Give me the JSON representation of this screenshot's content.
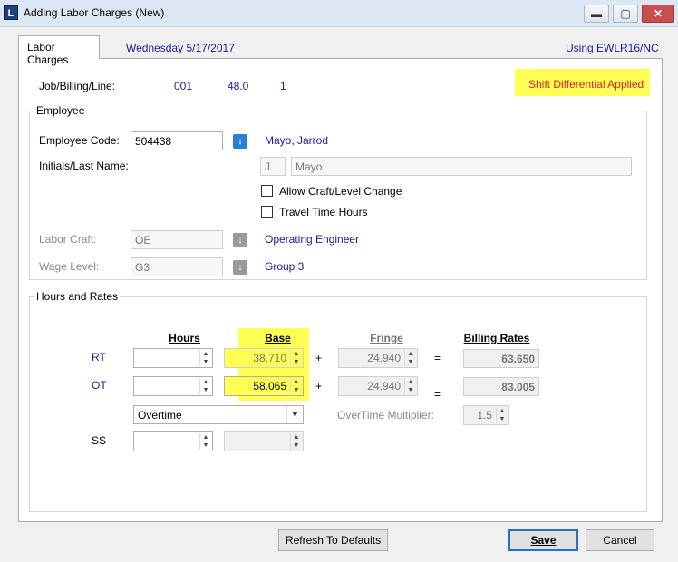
{
  "window": {
    "title": "Adding Labor Charges  (New)",
    "app_icon": "L",
    "minimize_glyph": "▬",
    "maximize_glyph": "▢",
    "close_glyph": "✕"
  },
  "tab": {
    "label": "Labor Charges"
  },
  "header": {
    "date": "Wednesday  5/17/2017",
    "using": "Using EWLR16/NC"
  },
  "job": {
    "label": "Job/Billing/Line:",
    "job": "001",
    "billing": "48.0",
    "line": "1",
    "shift_differential": "Shift Differential Applied"
  },
  "employee": {
    "group_title": "Employee",
    "code_label": "Employee Code:",
    "code_value": "504438",
    "name": "Mayo, Jarrod",
    "initials_label": "Initials/Last Name:",
    "initial": "J",
    "last_name": "Mayo",
    "allow_craft_label": "Allow Craft/Level Change",
    "allow_craft_checked": false,
    "travel_time_label": "Travel Time Hours",
    "travel_time_checked": false,
    "craft_label": "Labor Craft:",
    "craft_value": "OE",
    "craft_name": "Operating Engineer",
    "wage_label": "Wage Level:",
    "wage_value": "G3",
    "wage_name": "Group 3"
  },
  "hours": {
    "group_title": "Hours and Rates",
    "col_hours": "Hours",
    "col_base": "Base",
    "col_fringe": "Fringe",
    "col_billing": "Billing Rates",
    "plus": "+",
    "equals": "=",
    "rt_label": "RT",
    "rt_hours": "",
    "rt_base": "38.710",
    "rt_fringe": "24.940",
    "rt_billing": "63.650",
    "ot_label": "OT",
    "ot_hours": "",
    "ot_base": "58.065",
    "ot_fringe": "24.940",
    "ot_billing": "83.005",
    "ot_type": "Overtime",
    "ot_multiplier_label": "OverTime Multiplier:",
    "ot_multiplier": "1.5",
    "ss_label": "SS",
    "ss_hours": "",
    "ss_base": ""
  },
  "buttons": {
    "refresh": "Refresh To Defaults",
    "save": "Save",
    "cancel": "Cancel"
  },
  "colors": {
    "highlight": "#ffff55",
    "link_blue": "#1c1c9c",
    "warning_red": "#e02020",
    "default_button_border": "#2b6fc4"
  }
}
